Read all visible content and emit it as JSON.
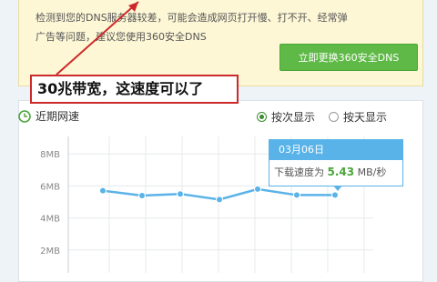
{
  "dns_banner": {
    "line1": "检测到您的DNS服务器较差，可能会造成网页打开慢、打不开、经常弹",
    "line2": "广告等问题，建议您使用360安全DNS",
    "button_label": "立即更换360安全DNS"
  },
  "annotation": {
    "text": "30兆带宽，这速度可以了",
    "color": "#cc2a2a"
  },
  "speed_panel": {
    "title": "近期网速",
    "title_icon": "clock-icon",
    "radio_by_count": "按次显示",
    "radio_by_day": "按天显示",
    "selected": "按次显示"
  },
  "tooltip": {
    "date": "03月06日",
    "prefix": "下载速度为",
    "value": "5.43",
    "unit": "MB/秒"
  },
  "chart_data": {
    "type": "line",
    "y_ticks": [
      "8MB",
      "6MB",
      "4MB",
      "2MB"
    ],
    "y_tick_values": [
      8,
      6,
      4,
      2
    ],
    "ylim": [
      0,
      8
    ],
    "grid": true,
    "series": [
      {
        "values": [
          5.7,
          5.4,
          5.5,
          5.15,
          5.8,
          5.43,
          5.43
        ]
      }
    ],
    "line_color": "#5ab3e8"
  }
}
